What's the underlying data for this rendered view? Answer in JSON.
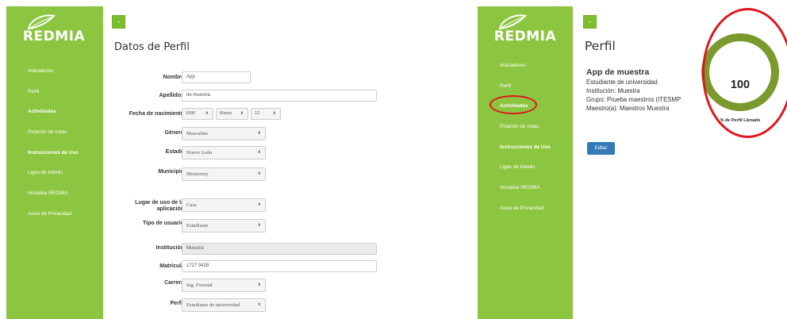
{
  "brand": {
    "name": "REDMIA",
    "green": "#8cc53f",
    "highlight": "#e0161c",
    "button_blue": "#337ab7"
  },
  "collapse_label": "-",
  "sidebar": {
    "items": [
      {
        "label": "Indicadores"
      },
      {
        "label": "Perfil"
      },
      {
        "label": "Actividades"
      },
      {
        "label": "Pizarrón de notas"
      },
      {
        "label": "Instrucciones de Uso"
      },
      {
        "label": "Ligas de interés"
      },
      {
        "label": "Iniciativa REDMIA"
      },
      {
        "label": "Aviso de Privacidad"
      }
    ]
  },
  "form": {
    "title": "Datos de Perfil",
    "nombre": {
      "label": "Nombre",
      "value": "App"
    },
    "apellidos": {
      "label": "Apellidos",
      "value": "de muestra"
    },
    "fecha": {
      "label": "Fecha de nacimiento",
      "year": "1990",
      "month": "Marzo",
      "day": "12"
    },
    "genero": {
      "label": "Género",
      "value": "Masculino"
    },
    "estado": {
      "label": "Estado",
      "value": "Nuevo León"
    },
    "municipio": {
      "label": "Municipio",
      "value": "Monterrey"
    },
    "lugar": {
      "label": "Lugar de uso de la aplicación",
      "value": "Casa"
    },
    "tipo": {
      "label": "Tipo de usuario",
      "value": "Estudiante"
    },
    "institucion": {
      "label": "Institución",
      "value": "Muestra"
    },
    "matricula": {
      "label": "Matrícula",
      "value": "1727 9428"
    },
    "carrera": {
      "label": "Carrera",
      "value": "Ing. Forestal"
    },
    "perfil": {
      "label": "Perfil",
      "value": "Estudiante de universidad"
    }
  },
  "profile": {
    "title": "Perfil",
    "name": "App de muestra",
    "role": "Estudiante de universidad",
    "institution": "Institución: Muestra",
    "group": "Grupo: Prueba maestros (ITESMP",
    "teacher": "Maestro(a): Maestros Muestra",
    "edit_label": "Editar",
    "completion": "100",
    "completion_fraction": 1.0,
    "completion_label": "% de Perfil Llenado"
  }
}
